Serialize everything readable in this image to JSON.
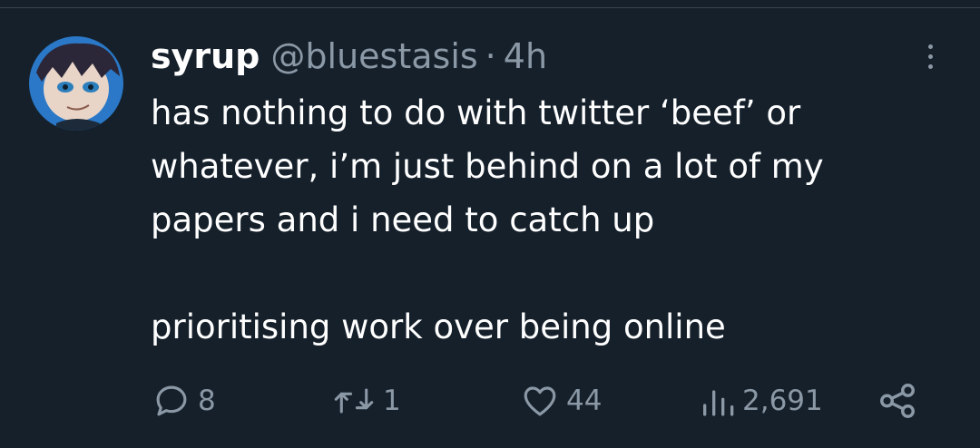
{
  "tweet": {
    "display_name": "syrup",
    "handle": "@bluestasis",
    "separator": "·",
    "time": "4h",
    "text_lines": [
      "has nothing to do with twitter ‘beef’ or",
      "whatever, i’m just behind on a lot of my",
      "papers and i need to catch up"
    ],
    "text_second_paragraph": "prioritising work over being online"
  },
  "actions": {
    "replies": "8",
    "retweets": "1",
    "likes": "44",
    "views": "2,691"
  },
  "icons": {
    "reply": "reply-icon",
    "retweet": "retweet-icon",
    "like": "heart-icon",
    "views": "views-icon",
    "share": "share-icon",
    "more": "more-vertical-icon"
  },
  "colors": {
    "background": "#15202b",
    "text": "#ffffff",
    "muted": "#8b98a5"
  }
}
